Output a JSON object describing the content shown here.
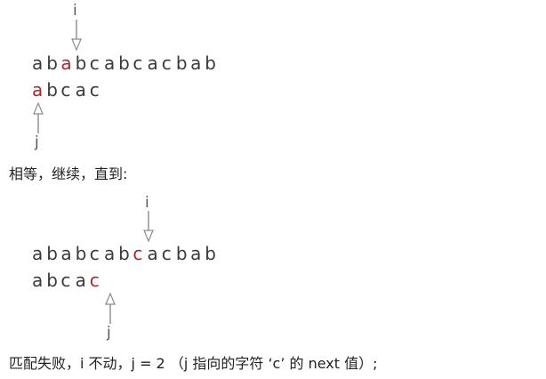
{
  "step1": {
    "pointer_i": "i",
    "pointer_j": "j",
    "text_chars": [
      "a",
      "b",
      "a",
      "b",
      "c",
      "a",
      "b",
      "c",
      "a",
      "c",
      "b",
      "a",
      "b"
    ],
    "pattern_chars": [
      "a",
      "b",
      "c",
      "a",
      "c"
    ],
    "text_highlight_index": 2,
    "pattern_highlight_index": 0
  },
  "caption1": "相等，继续，直到:",
  "step2": {
    "pointer_i": "i",
    "pointer_j": "j",
    "text_chars": [
      "a",
      "b",
      "a",
      "b",
      "c",
      "a",
      "b",
      "c",
      "a",
      "c",
      "b",
      "a",
      "b"
    ],
    "pattern_chars": [
      "a",
      "b",
      "c",
      "a",
      "c"
    ],
    "text_highlight_index": 7,
    "pattern_highlight_index": 4
  },
  "caption2": "匹配失败，i 不动，j = 2 （j 指向的字符 ‘c’ 的 next 值）;",
  "colors": {
    "highlight": "#b0242e",
    "text": "#3b3b3b",
    "arrow": "#8c8c8c"
  }
}
